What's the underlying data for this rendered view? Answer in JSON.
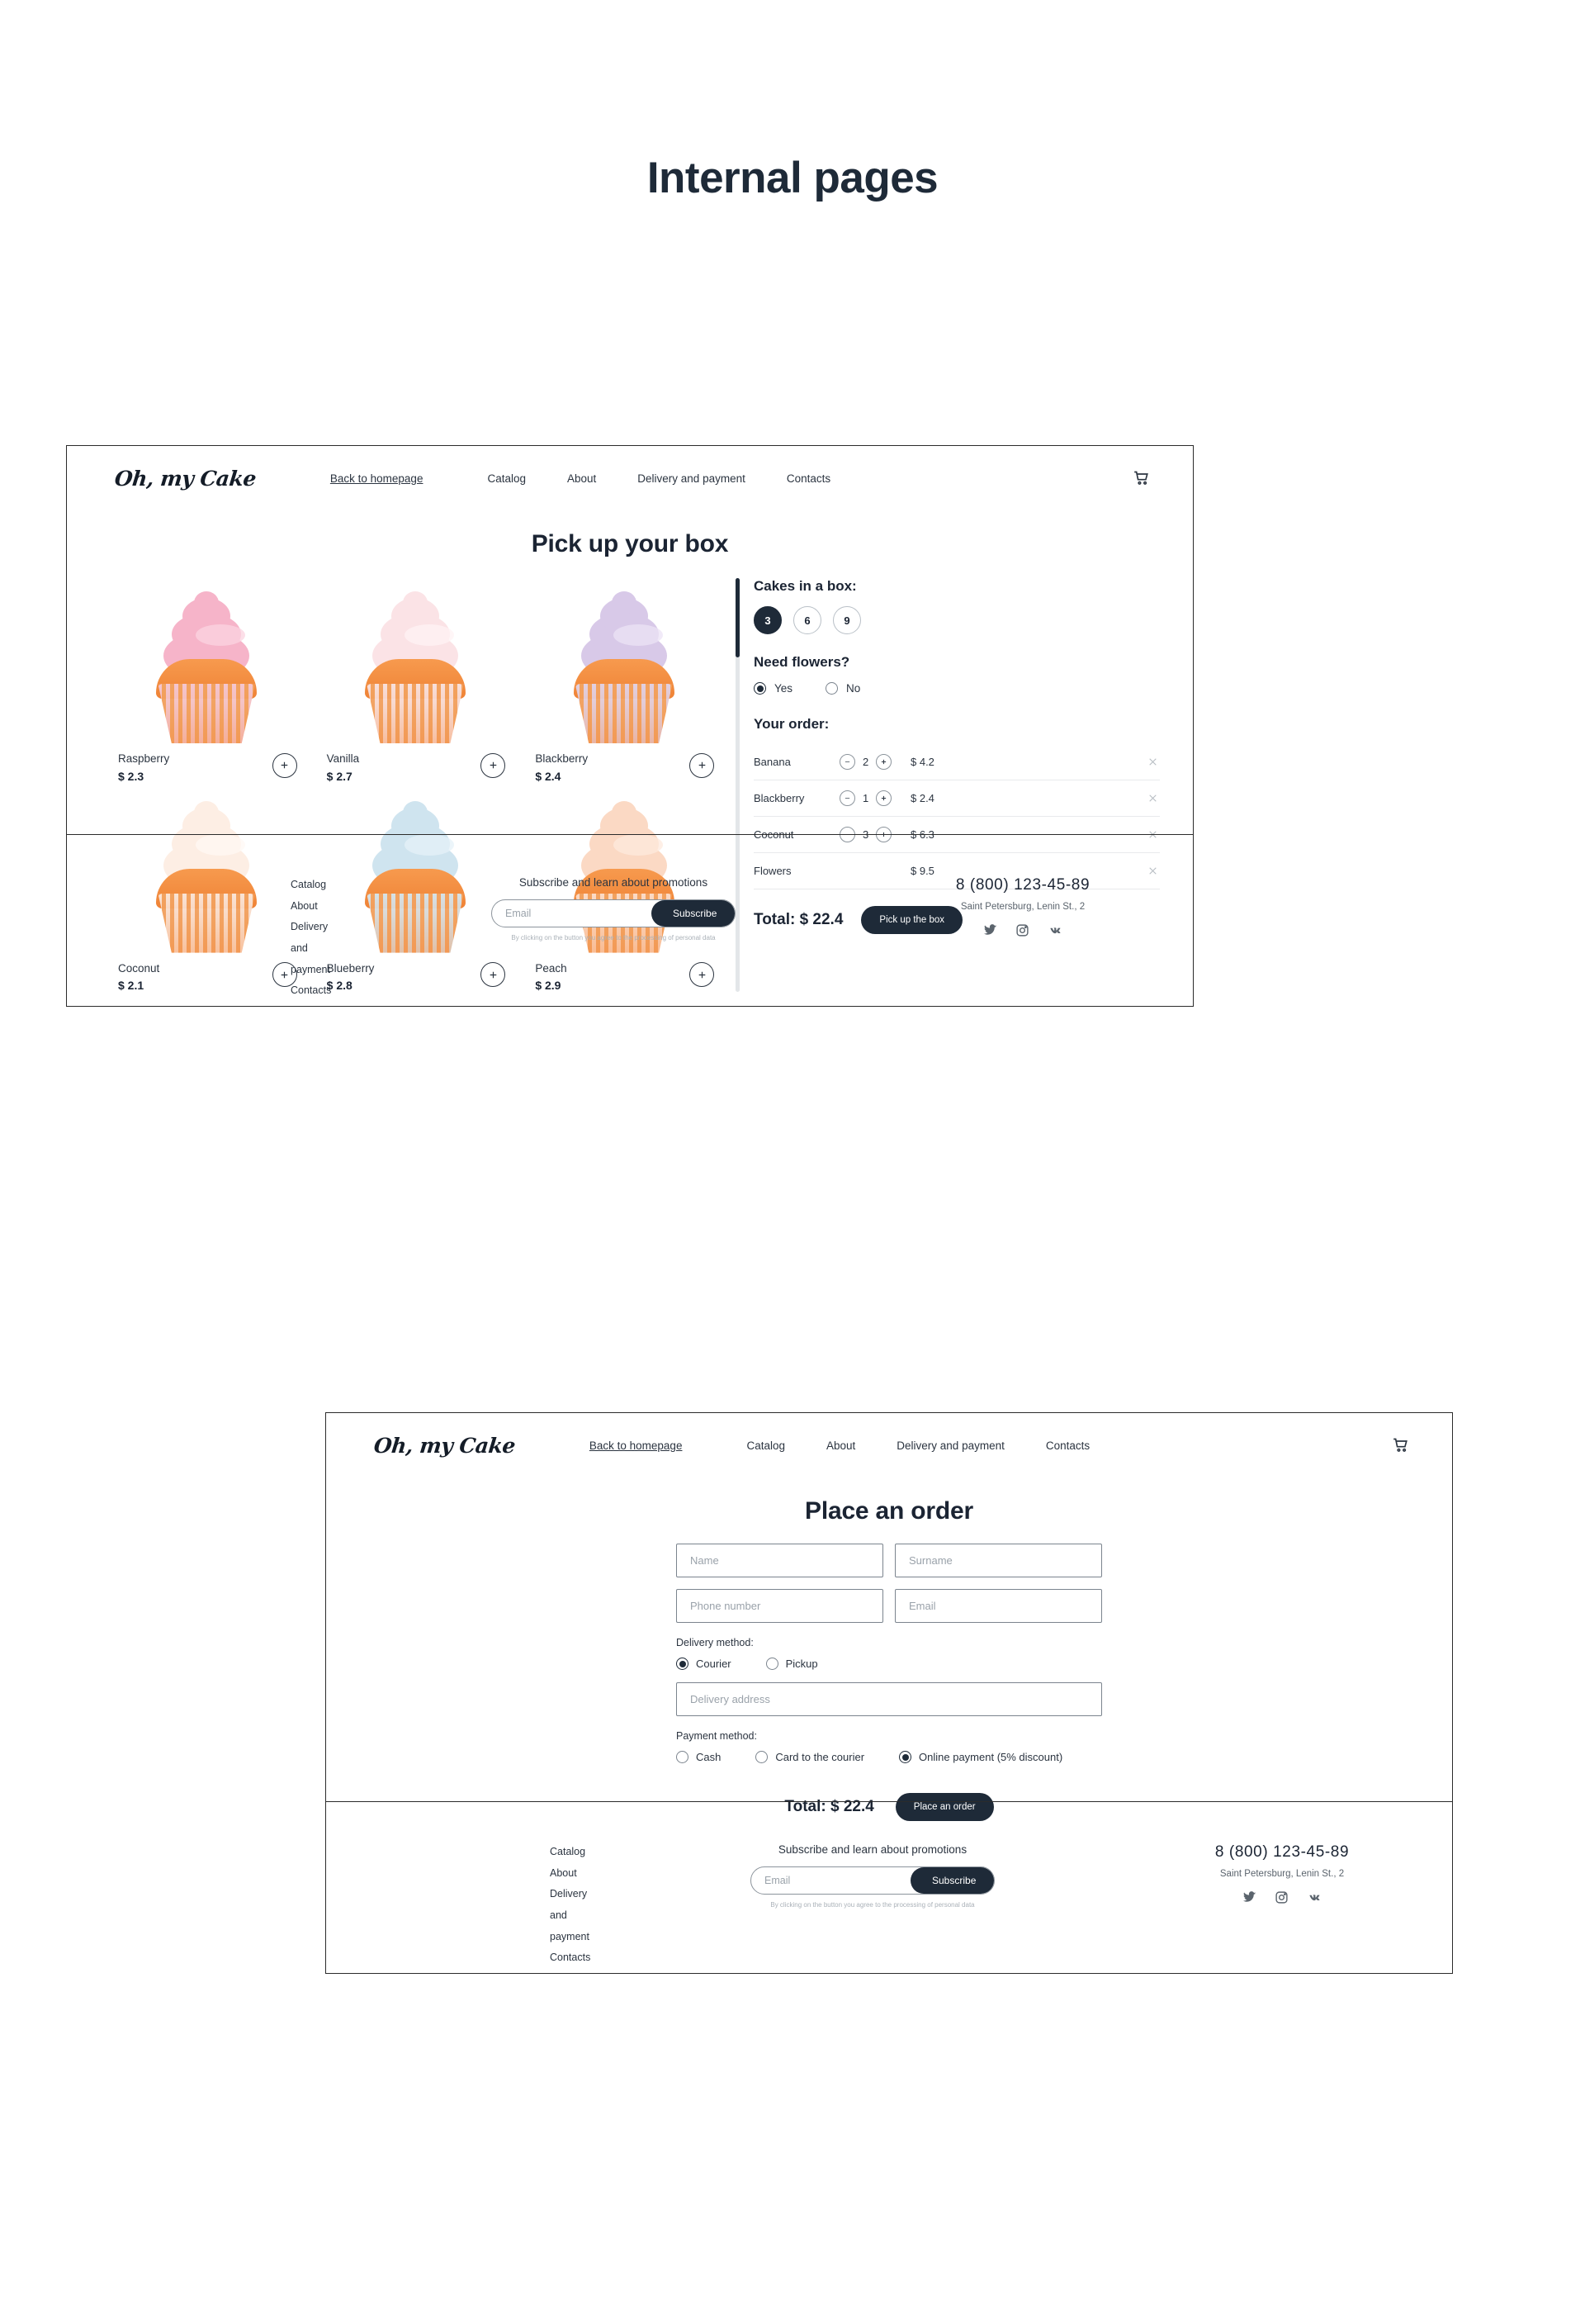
{
  "page": {
    "title": "Internal pages"
  },
  "brand": {
    "logo": "Oh, my Cake"
  },
  "nav": {
    "home": "Back to homepage",
    "catalog": "Catalog",
    "about": "About",
    "delivery": "Delivery and payment",
    "contacts": "Contacts",
    "cart_icon": "shopping-cart-icon"
  },
  "catalog_page": {
    "heading": "Pick up your box",
    "products": [
      {
        "name": "Raspberry",
        "price": "$ 2.3",
        "frost": "#f6b4c9",
        "frost2": "#fbd4e0",
        "cup": "#f3c4d4",
        "cup_dark": "#f09a50"
      },
      {
        "name": "Vanilla",
        "price": "$ 2.7",
        "frost": "#fbe3e6",
        "frost2": "#fff3f4",
        "cup": "#f7e2e2",
        "cup_dark": "#f09a50"
      },
      {
        "name": "Blackberry",
        "price": "$ 2.4",
        "frost": "#d8c9e8",
        "frost2": "#ece3f5",
        "cup": "#dcd0ea",
        "cup_dark": "#f09a50"
      },
      {
        "name": "Coconut",
        "price": "$ 2.1",
        "frost": "#fdeee4",
        "frost2": "#fff8f4",
        "cup": "#f9e6da",
        "cup_dark": "#f09a50"
      },
      {
        "name": "Blueberry",
        "price": "$ 2.8",
        "frost": "#cfe4ef",
        "frost2": "#e6f2f8",
        "cup": "#cfe4ef",
        "cup_dark": "#f09a50"
      },
      {
        "name": "Peach",
        "price": "$ 2.9",
        "frost": "#fbd9c4",
        "frost2": "#fdeadd",
        "cup": "#fbdcc8",
        "cup_dark": "#f09a50"
      }
    ],
    "add_icon": "plus-icon",
    "panel": {
      "cakes_title": "Cakes in a box:",
      "cake_counts": [
        "3",
        "6",
        "9"
      ],
      "cake_count_selected": "3",
      "flowers_title": "Need flowers?",
      "flowers_yes": "Yes",
      "flowers_no": "No",
      "flowers_selected": "Yes",
      "order_title": "Your order:",
      "order_items": [
        {
          "name": "Banana",
          "qty": "2",
          "price": "$ 4.2",
          "has_stepper": true
        },
        {
          "name": "Blackberry",
          "qty": "1",
          "price": "$ 2.4",
          "has_stepper": true
        },
        {
          "name": "Coconut",
          "qty": "3",
          "price": "$ 6.3",
          "has_stepper": true
        },
        {
          "name": "Flowers",
          "qty": "",
          "price": "$ 9.5",
          "has_stepper": false
        }
      ],
      "total": "Total: $ 22.4",
      "cta": "Pick up the box",
      "minus_icon": "minus-icon",
      "plus_icon": "plus-icon",
      "remove_icon": "close-icon"
    }
  },
  "order_page": {
    "heading": "Place an order",
    "fields": {
      "name": "Name",
      "surname": "Surname",
      "phone": "Phone number",
      "email": "Email",
      "address": "Delivery address"
    },
    "delivery_label": "Delivery method:",
    "delivery_options": [
      "Courier",
      "Pickup"
    ],
    "delivery_selected": "Courier",
    "payment_label": "Payment method:",
    "payment_options": [
      "Cash",
      "Card to the courier",
      "Online payment (5% discount)"
    ],
    "payment_selected": "Online payment (5% discount)",
    "total": "Total: $ 22.4",
    "cta": "Place an order"
  },
  "footer": {
    "links": [
      "Catalog",
      "About",
      "Delivery and payment",
      "Contacts"
    ],
    "subscribe_title": "Subscribe and learn about promotions",
    "email_placeholder": "Email",
    "subscribe_btn": "Subscribe",
    "note": "By clicking on the button you agree to the processing of personal data",
    "phone": "8 (800) 123-45-89",
    "address": "Saint Petersburg, Lenin St., 2",
    "social": [
      "twitter-icon",
      "instagram-icon",
      "vk-icon"
    ]
  },
  "colors": {
    "dark": "#1e2a38",
    "text": "#2b3440",
    "muted": "#9aa2aa"
  }
}
